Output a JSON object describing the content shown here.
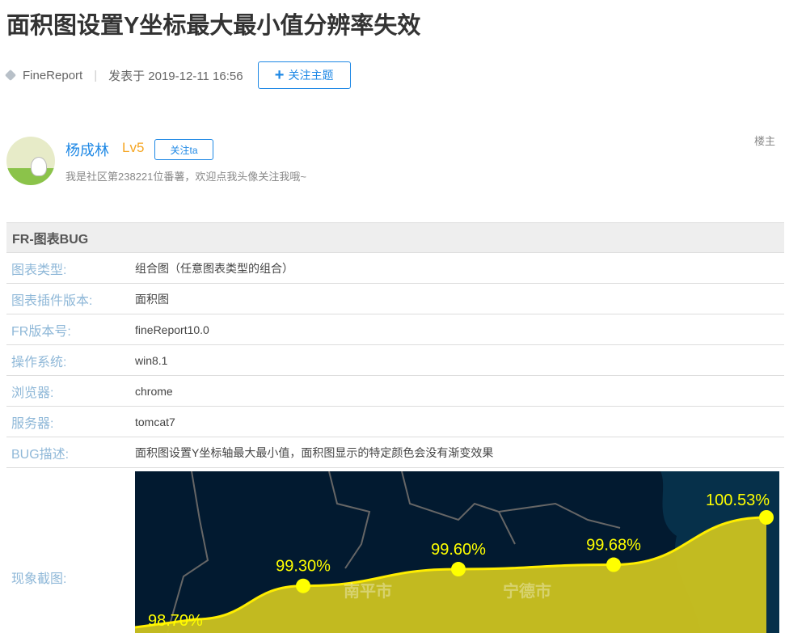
{
  "title": "面积图设置Y坐标最大最小值分辨率失效",
  "meta": {
    "tag": "FineReport",
    "separator": "|",
    "posted": "发表于 2019-12-11 16:56",
    "follow_topic_icon": "+",
    "follow_topic_label": "关注主题"
  },
  "author": {
    "name": "杨成林",
    "level": "Lv5",
    "follow_label": "关注ta",
    "signature": "我是社区第238221位番薯，欢迎点我头像关注我哦~",
    "role": "楼主"
  },
  "form": {
    "header": "FR-图表BUG",
    "rows": [
      {
        "key": "图表类型:",
        "value": "组合图（任意图表类型的组合）"
      },
      {
        "key": "图表插件版本:",
        "value": "面积图"
      },
      {
        "key": "FR版本号:",
        "value": "fineReport10.0"
      },
      {
        "key": "操作系统:",
        "value": "win8.1"
      },
      {
        "key": "浏览器:",
        "value": "chrome"
      },
      {
        "key": "服务器:",
        "value": "tomcat7"
      },
      {
        "key": "BUG描述:",
        "value": "面积图设置Y坐标轴最大最小值，面积图显示的特定颜色会没有渐变效果"
      }
    ],
    "screenshot_key": "现象截图:"
  },
  "screenshot": {
    "points": [
      {
        "label": "98.70%",
        "value": 98.7
      },
      {
        "label": "99.30%",
        "value": 99.3
      },
      {
        "label": "99.60%",
        "value": 99.6
      },
      {
        "label": "99.68%",
        "value": 99.68
      },
      {
        "label": "100.53%",
        "value": 100.53
      }
    ],
    "cities": [
      "南平市",
      "宁德市"
    ],
    "colors": {
      "bg": "#021a30",
      "sea": "#06304a",
      "area": "#c8c020",
      "line": "#ffee00",
      "label": "#ffff00"
    }
  }
}
